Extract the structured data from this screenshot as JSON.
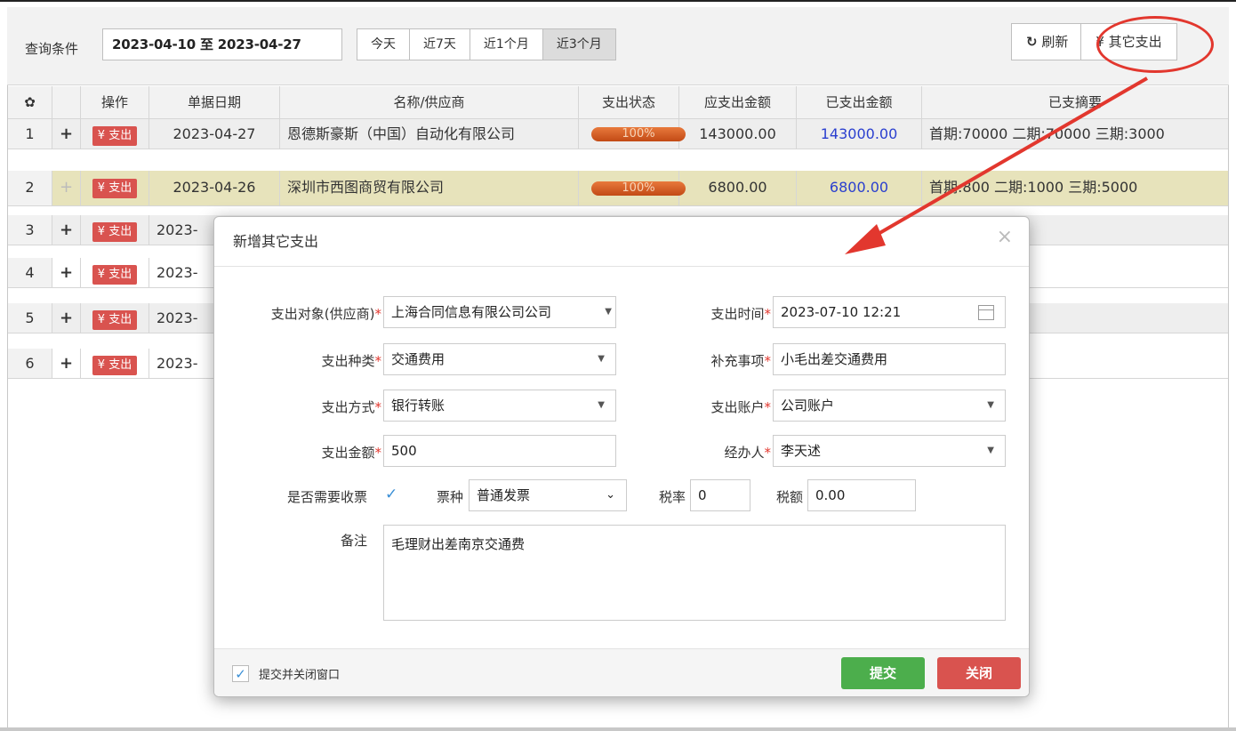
{
  "toolbar": {
    "query_label": "查询条件",
    "date_range": "2023-04-10 至 2023-04-27",
    "quick_ranges": [
      "今天",
      "近7天",
      "近1个月",
      "近3个月"
    ],
    "refresh_icon": "refresh-icon",
    "refresh_label": "刷新",
    "other_expense_label": "¥ 其它支出"
  },
  "table": {
    "headers": [
      "操作",
      "单据日期",
      "名称/供应商",
      "支出状态",
      "应支出金额",
      "已支出金额",
      "已支摘要"
    ],
    "settings_icon": "gear-icon",
    "pay_label": "¥ 支出",
    "rows": [
      {
        "no": "1",
        "date": "2023-04-27",
        "name": "恩德斯豪斯（中国）自动化有限公司",
        "status": "100%",
        "due": "143000.00",
        "paid": "143000.00",
        "summary": "首期:70000 二期:70000 三期:3000"
      },
      {
        "no": "2",
        "date": "2023-04-26",
        "name": "深圳市西图商贸有限公司",
        "status": "100%",
        "due": "6800.00",
        "paid": "6800.00",
        "summary": "首期:800 二期:1000 三期:5000"
      },
      {
        "no": "3",
        "date": "2023-"
      },
      {
        "no": "4",
        "date": "2023-"
      },
      {
        "no": "5",
        "date": "2023-"
      },
      {
        "no": "6",
        "date": "2023-"
      }
    ]
  },
  "dialog": {
    "title": "新增其它支出",
    "close": "×",
    "fields": {
      "target_label": "支出对象(供应商)",
      "target_value": "上海合同信息有限公司公司",
      "time_label": "支出时间",
      "time_value": "2023-07-10 12:21",
      "type_label": "支出种类",
      "type_value": "交通费用",
      "extra_label": "补充事项",
      "extra_value": "小毛出差交通费用",
      "method_label": "支出方式",
      "method_value": "银行转账",
      "account_label": "支出账户",
      "account_value": "公司账户",
      "amount_label": "支出金额",
      "amount_value": "500",
      "handler_label": "经办人",
      "handler_value": "李天述",
      "invoice_label": "是否需要收票",
      "invoice_checked": true,
      "ticket_label": "票种",
      "ticket_value": "普通发票",
      "taxrate_label": "税率",
      "taxrate_value": "0",
      "tax_label": "税额",
      "tax_value": "0.00",
      "note_label": "备注",
      "note_value": "毛理财出差南京交通费"
    },
    "footer": {
      "close_after_submit_label": "提交并关闭窗口",
      "close_after_submit_checked": true,
      "submit_label": "提交",
      "close_label": "关闭"
    }
  },
  "colors": {
    "accent_red": "#e2372e",
    "pay_red": "#d9534f",
    "submit_green": "#4cae4c",
    "close_red": "#d9534f",
    "paid_blue": "#2a3fcf",
    "selected_row": "#e7e3bb"
  }
}
